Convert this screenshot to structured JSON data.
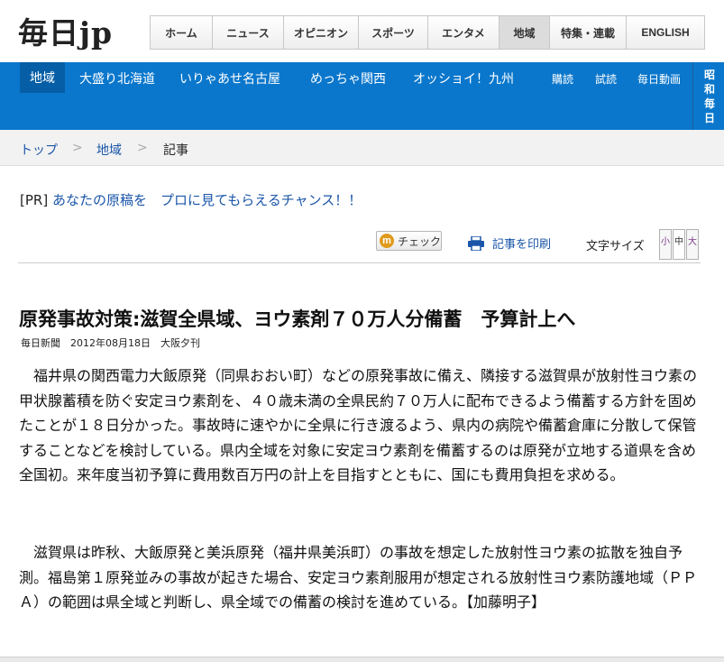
{
  "header": {
    "logo": "毎日jp",
    "nav": [
      {
        "label": "ホーム",
        "active": false
      },
      {
        "label": "ニュース",
        "active": false
      },
      {
        "label": "オピニオン",
        "active": false
      },
      {
        "label": "スポーツ",
        "active": false
      },
      {
        "label": "エンタメ",
        "active": false
      },
      {
        "label": "地域",
        "active": true
      },
      {
        "label": "特集・連載",
        "active": false
      },
      {
        "label": "ENGLISH",
        "active": false
      }
    ]
  },
  "bluebar": {
    "current": "地域",
    "regions": [
      "大盛り北海道",
      "いりゃあせ名古屋",
      "めっちゃ関西",
      "オッショイ！九州"
    ],
    "links": [
      "購読",
      "試読",
      "毎日動画"
    ],
    "vertical": [
      "昭",
      "和",
      "毎",
      "日"
    ]
  },
  "breadcrumb": {
    "items": [
      "トップ",
      "地域",
      "記事"
    ],
    "separator": ">"
  },
  "pr": {
    "tag": "[PR]",
    "text": "あなたの原稿を　プロに見てもらえるチャンス！！"
  },
  "tools": {
    "check_label": "チェック",
    "check_icon": "mixi-m-icon",
    "print_label": "記事を印刷",
    "print_icon": "printer-icon",
    "fontsize_label": "文字サイズ",
    "sizes": [
      "小",
      "中",
      "大"
    ]
  },
  "article": {
    "headline": "原発事故対策:滋賀全県域、ヨウ素剤７０万人分備蓄　予算計上へ",
    "dateline": "毎日新聞　2012年08月18日　大阪夕刊",
    "paragraphs": [
      "福井県の関西電力大飯原発（同県おおい町）などの原発事故に備え、隣接する滋賀県が放射性ヨウ素の甲状腺蓄積を防ぐ安定ヨウ素剤を、４０歳未満の全県民約７０万人に配布できるよう備蓄する方針を固めたことが１８日分かった。事故時に速やかに全県に行き渡るよう、県内の病院や備蓄倉庫に分散して保管することなどを検討している。県内全域を対象に安定ヨウ素剤を備蓄するのは原発が立地する道県を含め全国初。来年度当初予算に費用数百万円の計上を目指すとともに、国にも費用負担を求める。",
      "滋賀県は昨秋、大飯原発と美浜原発（福井県美浜町）の事故を想定した放射性ヨウ素の拡散を独自予測。福島第１原発並みの事故が起きた場合、安定ヨウ素剤服用が想定される放射性ヨウ素防護地域（ＰＰＡ）の範囲は県全域と判断し、県全域での備蓄の検討を進めている。【加藤明子】"
    ]
  }
}
